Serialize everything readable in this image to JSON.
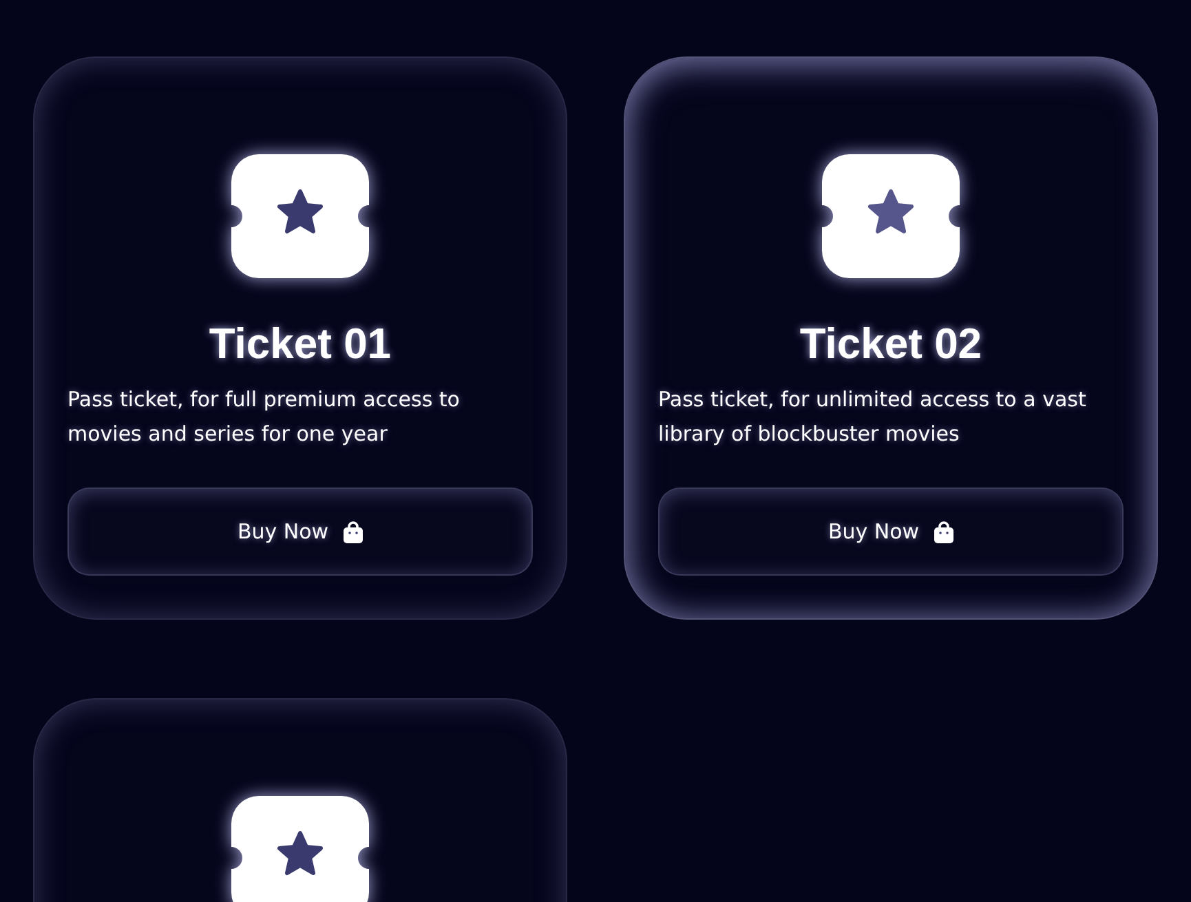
{
  "cards": [
    {
      "title": "Ticket 01",
      "description": "Pass ticket, for full premium access to movies and series for one year",
      "button": "Buy Now",
      "hovered": false
    },
    {
      "title": "Ticket 02",
      "description": "Pass ticket, for unlimited access to a vast library of blockbuster movies",
      "button": "Buy Now",
      "hovered": true
    },
    {
      "hovered": false
    }
  ]
}
